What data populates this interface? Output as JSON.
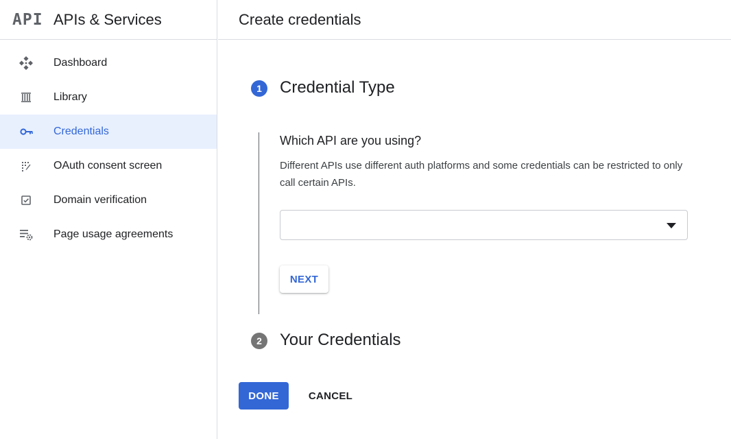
{
  "sidebar": {
    "logo_text": "API",
    "product_title": "APIs & Services",
    "items": [
      {
        "label": "Dashboard",
        "icon": "dashboard-icon"
      },
      {
        "label": "Library",
        "icon": "library-icon"
      },
      {
        "label": "Credentials",
        "icon": "key-icon",
        "active": true
      },
      {
        "label": "OAuth consent screen",
        "icon": "consent-icon"
      },
      {
        "label": "Domain verification",
        "icon": "checkbox-icon"
      },
      {
        "label": "Page usage agreements",
        "icon": "settings-list-icon"
      }
    ]
  },
  "header": {
    "title": "Create credentials"
  },
  "steps": [
    {
      "number": "1",
      "title": "Credential Type",
      "state": "active"
    },
    {
      "number": "2",
      "title": "Your Credentials",
      "state": "inactive"
    }
  ],
  "form": {
    "question": "Which API are you using?",
    "helptext": "Different APIs use different auth platforms and some credentials can be restricted to only call certain APIs.",
    "select_value": "",
    "next_label": "NEXT"
  },
  "actions": {
    "done_label": "DONE",
    "cancel_label": "CANCEL"
  },
  "colors": {
    "accent": "#3367d6",
    "active_bg": "#e8f0fe",
    "divider": "#dadce0",
    "inactive_step": "#757575"
  }
}
